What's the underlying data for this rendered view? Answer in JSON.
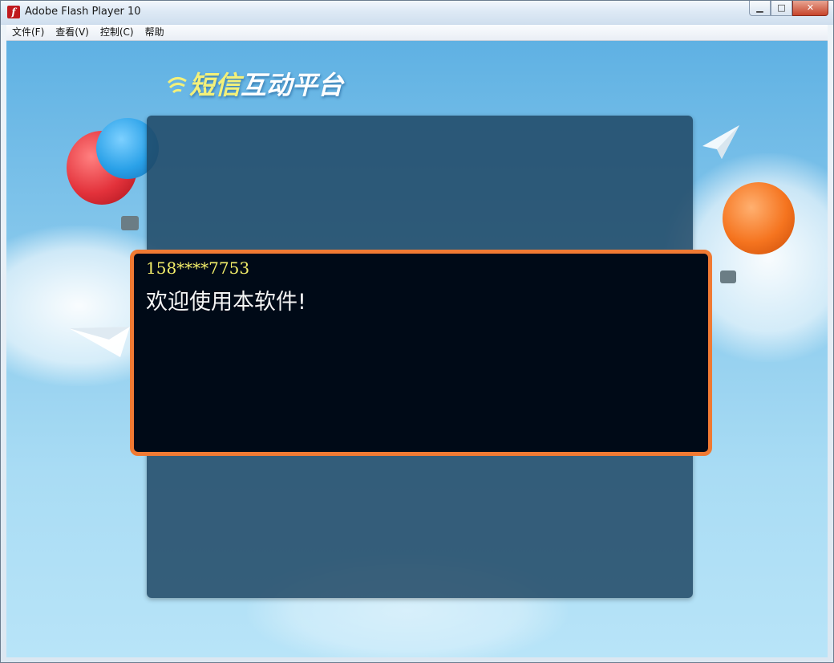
{
  "window": {
    "title": "Adobe Flash Player 10",
    "icon": "flash-player-icon"
  },
  "window_controls": {
    "minimize": "minimize-icon",
    "maximize": "maximize-icon",
    "close": "close-icon"
  },
  "menu": [
    {
      "label": "文件(F)"
    },
    {
      "label": "查看(V)"
    },
    {
      "label": "控制(C)"
    },
    {
      "label": "帮助"
    }
  ],
  "app": {
    "logo_highlight": "短信",
    "logo_rest": "互动平台"
  },
  "message": {
    "sender": "158****7753",
    "text": "欢迎使用本软件!"
  },
  "colors": {
    "message_border": "#f07a33",
    "sender_text": "#f3ef6a",
    "message_text": "#f4f4f4",
    "panel": "#1e4664"
  }
}
